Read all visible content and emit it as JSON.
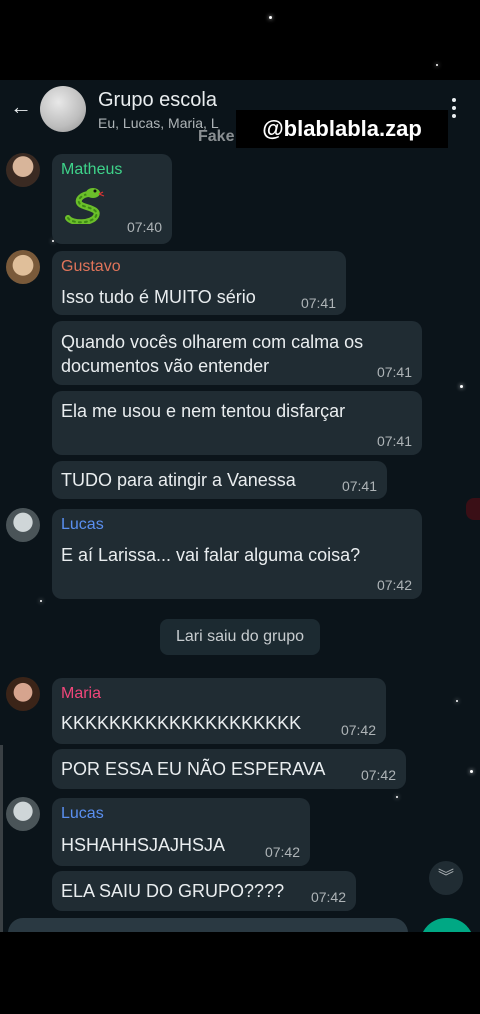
{
  "header": {
    "back_icon": "arrow-left-icon",
    "group_name": "Grupo escola",
    "members": "Eu, Lucas, Maria, L",
    "overlay_text": "Fake",
    "watermark": "@blablabla.zap",
    "menu_icon": "more-vertical-icon"
  },
  "messages": [
    {
      "sender": "Matheus",
      "sticker": "snake-emoji",
      "time": "07:40"
    },
    {
      "sender": "Gustavo",
      "text": "Isso tudo é MUITO sério",
      "time": "07:41"
    },
    {
      "text_line1": "Quando vocês olharem com calma os",
      "text_line2": "documentos vão entender",
      "time": "07:41"
    },
    {
      "text": "Ela me usou e nem tentou disfarçar",
      "time": "07:41"
    },
    {
      "text": "TUDO para atingir a Vanessa",
      "time": "07:41"
    },
    {
      "sender": "Lucas",
      "text": "E aí Larissa... vai falar alguma coisa?",
      "time": "07:42"
    },
    {
      "sender": "Maria",
      "text": "KKKKKKKKKKKKKKKKKKKK",
      "time": "07:42"
    },
    {
      "text": "POR ESSA EU NÃO ESPERAVA",
      "time": "07:42"
    },
    {
      "sender": "Lucas",
      "text": "HSHAHHSJAJHSJA",
      "time": "07:42"
    },
    {
      "text": "ELA SAIU DO GRUPO????",
      "time": "07:42"
    }
  ],
  "system_message": "Lari saiu do grupo",
  "scroll_icon": "chevron-double-down-icon",
  "colors": {
    "background": "#0b141a",
    "bubble": "#202c33",
    "matheus": "#3ed38a",
    "gustavo": "#e0745a",
    "lucas": "#5a8ff0",
    "maria": "#f0467a",
    "send": "#00a884"
  }
}
